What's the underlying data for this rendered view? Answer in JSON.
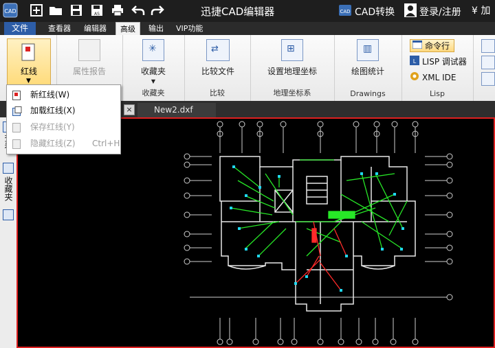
{
  "titlebar": {
    "app_title": "迅捷CAD编辑器",
    "cad_convert": "CAD转换",
    "login": "登录/注册",
    "right_cut": "¥ 加"
  },
  "menu": {
    "file": "文件",
    "tabs": [
      "查看器",
      "编辑器",
      "高级",
      "输出",
      "VIP功能"
    ],
    "active_tab": "高级"
  },
  "ribbon": {
    "redline": "红线",
    "attr_report": "属性报告",
    "favorites": "收藏夹",
    "favorites_group": "收藏夹",
    "compare_files": "比较文件",
    "compare_group": "比较",
    "set_geo": "设置地理坐标",
    "geo_group": "地理坐标系",
    "drawing_stats": "绘图统计",
    "drawings_group": "Drawings",
    "cmdline": "命令行",
    "lisp_debugger": "LISP 调试器",
    "xml_ide": "XML IDE",
    "lisp_group": "Lisp"
  },
  "dropdown": {
    "items": [
      {
        "label": "新红线(W)",
        "shortcut": "",
        "enabled": true
      },
      {
        "label": "加载红线(X)",
        "shortcut": "",
        "enabled": true
      },
      {
        "label": "保存红线(Y)",
        "shortcut": "",
        "enabled": false
      },
      {
        "label": "隐藏红线(Z)",
        "shortcut": "Ctrl+H",
        "enabled": false
      }
    ]
  },
  "document": {
    "tab_name": "New2.dxf",
    "close_symbol": "×"
  },
  "sidepanel": {
    "labels": [
      "查看",
      "收藏夹"
    ]
  },
  "colors": {
    "accent_blue": "#2d5da7",
    "canvas_border": "#e02020",
    "highlight_yellow": "#ffd76d"
  }
}
